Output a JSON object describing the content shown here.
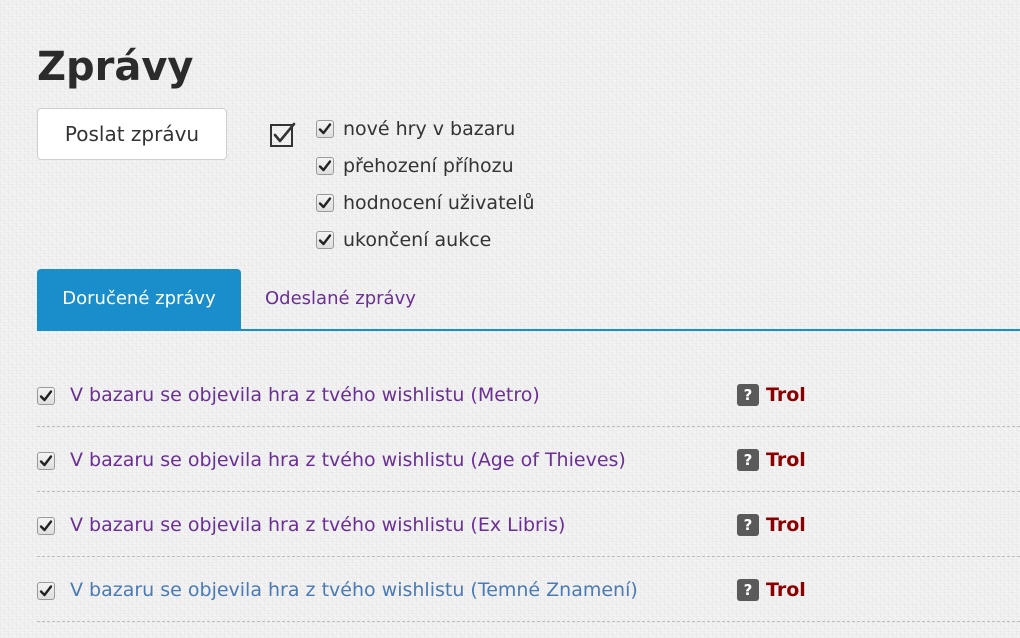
{
  "page": {
    "title": "Zprávy"
  },
  "actions": {
    "send_label": "Poslat zprávu"
  },
  "filters": {
    "items": [
      {
        "label": "nové hry v bazaru",
        "checked": true
      },
      {
        "label": "přehození příhozu",
        "checked": true
      },
      {
        "label": "hodnocení uživatelů",
        "checked": true
      },
      {
        "label": "ukončení aukce",
        "checked": true
      }
    ]
  },
  "tabs": [
    {
      "label": "Doručené zprávy",
      "active": true
    },
    {
      "label": "Odeslané zprávy",
      "active": false
    }
  ],
  "messages": [
    {
      "subject": "V bazaru se objevila hra z tvého wishlistu (Metro)",
      "help": "?",
      "sender": "Trol",
      "checked": true
    },
    {
      "subject": "V bazaru se objevila hra z tvého wishlistu (Age of Thieves)",
      "help": "?",
      "sender": "Trol",
      "checked": true
    },
    {
      "subject": "V bazaru se objevila hra z tvého wishlistu (Ex Libris)",
      "help": "?",
      "sender": "Trol",
      "checked": true
    },
    {
      "subject": "V bazaru se objevila hra z tvého wishlistu (Temné Znamení)",
      "help": "?",
      "sender": "Trol",
      "checked": true
    }
  ],
  "colors": {
    "accent": "#1a8dcb",
    "link": "#6a2f93",
    "sender": "#8b0000",
    "badge": "#5a5a5a"
  }
}
